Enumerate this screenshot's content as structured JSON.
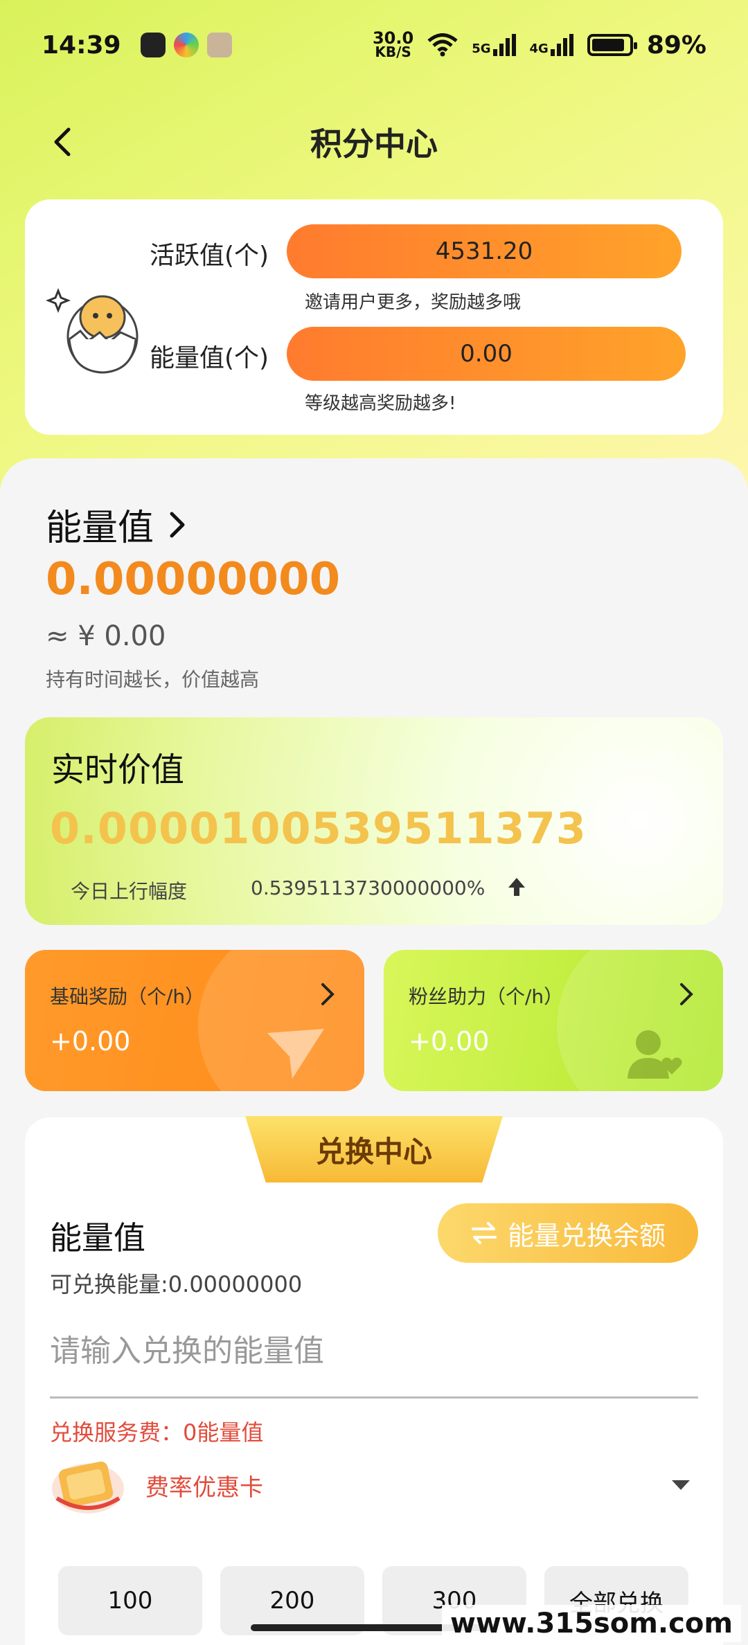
{
  "status_bar": {
    "time": "14:39",
    "net_speed_value": "30.0",
    "net_speed_unit": "KB/S",
    "signal_1": "5G",
    "signal_2": "4G",
    "battery": "89%"
  },
  "nav": {
    "title": "积分中心"
  },
  "score_card": {
    "activity_label": "活跃值(个)",
    "activity_value": "4531.20",
    "activity_hint": "邀请用户更多，奖励越多哦",
    "energy_label": "能量值(个)",
    "energy_value": "0.00",
    "energy_hint": "等级越高奖励越多!"
  },
  "energy": {
    "title": "能量值",
    "value": "0.00000000",
    "approx": "≈ ¥ 0.00",
    "hint": "持有时间越长，价值越高"
  },
  "realtime": {
    "title": "实时价值",
    "value": "0.0000100539511373",
    "today_label": "今日上行幅度",
    "today_pct": "0.5395113730000000%"
  },
  "rewards": {
    "base": {
      "label": "基础奖励（个/h）",
      "value": "+0.00"
    },
    "fans": {
      "label": "粉丝助力（个/h）",
      "value": "+0.00"
    }
  },
  "exchange": {
    "tab_title": "兑换中心",
    "label": "能量值",
    "available": "可兑换能量:0.00000000",
    "switch_button": "能量兑换余额",
    "input_placeholder": "请输入兑换的能量值",
    "fee": "兑换服务费：0能量值",
    "coupon": "费率优惠卡",
    "amounts": [
      "100",
      "200",
      "300",
      "全部兑换"
    ]
  },
  "watermark": "www.315som.com",
  "colors": {
    "accent_orange": "#f28a1e",
    "realtime_gold": "#f3c34e",
    "fee_red": "#e24b3b"
  }
}
